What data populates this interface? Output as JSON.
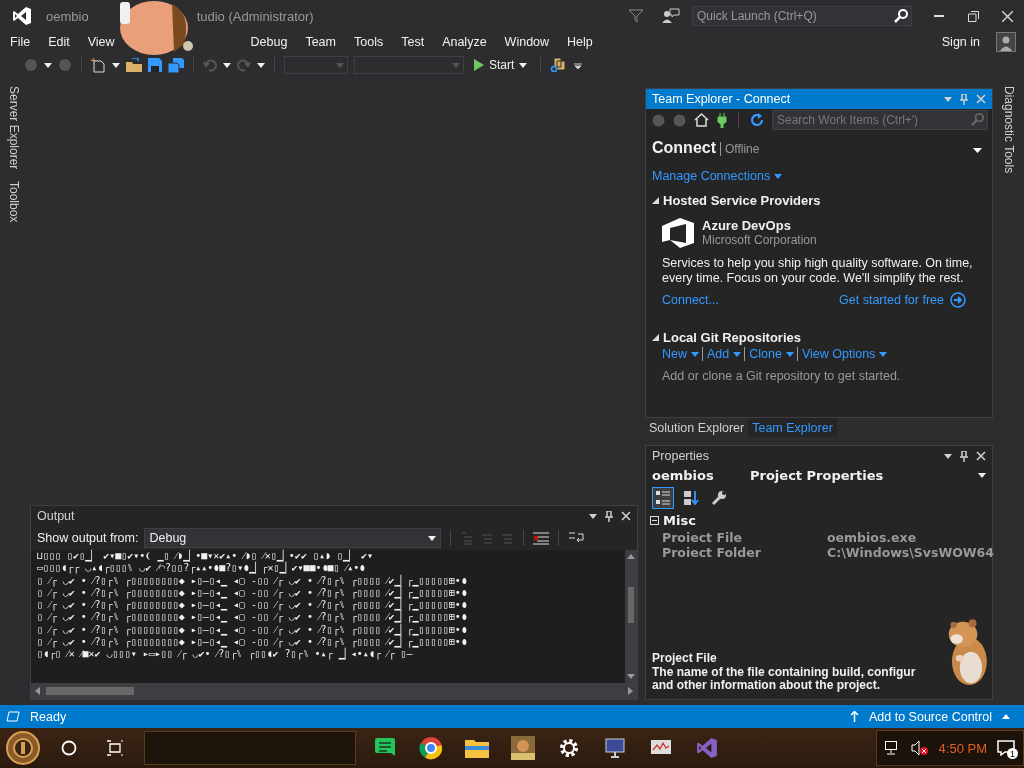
{
  "title_bar": {
    "title_start": "oembio",
    "title_end": "tudio  (Administrator)",
    "quick_launch": {
      "placeholder": "Quick Launch (Ctrl+Q)"
    }
  },
  "menu": {
    "items_before_overlay": [
      "File",
      "Edit",
      "View"
    ],
    "items_after_overlay": [
      "Debug",
      "Team",
      "Tools",
      "Test",
      "Analyze",
      "Window",
      "Help"
    ]
  },
  "account": {
    "sign_in": "Sign in"
  },
  "toolbar": {
    "start": "Start"
  },
  "side_tabs_left": [
    "Server Explorer",
    "Toolbox"
  ],
  "side_tabs_right": [
    "Diagnostic Tools"
  ],
  "team_explorer": {
    "title": "Team Explorer - Connect",
    "active": true,
    "search": {
      "placeholder": "Search Work Items (Ctrl+')"
    },
    "heading": "Connect",
    "status": "Offline",
    "manage": "Manage Connections",
    "hosted": {
      "title": "Hosted Service Providers",
      "expanded": true,
      "provider": "Azure DevOps",
      "company": "Microsoft Corporation",
      "description": "Services to help you ship high quality software. On time, every time. Focus on your code. We'll simplify the rest.",
      "connect": "Connect...",
      "get_started": "Get started for free"
    },
    "local_git": {
      "title": "Local Git Repositories",
      "expanded": true,
      "actions": [
        "New",
        "Add",
        "Clone",
        "View Options"
      ],
      "hint": "Add or clone a Git repository to get started."
    }
  },
  "panel_tabs": [
    {
      "label": "Solution Explorer",
      "selected": false
    },
    {
      "label": "Team Explorer",
      "selected": true
    }
  ],
  "properties": {
    "title": "Properties",
    "active": false,
    "object": "oembios",
    "object_type": "Project Properties",
    "view_buttons": [
      {
        "kind": "categorized",
        "selected": true
      },
      {
        "kind": "alphabetical",
        "selected": false
      },
      {
        "kind": "property-pages",
        "selected": false
      }
    ],
    "category": {
      "name": "Misc",
      "expanded": true,
      "rows": [
        {
          "name": "Proiect File",
          "value": "oembios.exe"
        },
        {
          "name": "Proiect Folder",
          "value": "C:\\Windows\\SvsWOW64"
        }
      ]
    },
    "description_title": "Project File",
    "description": "The name of the file containing build, configur\nand other information about the project."
  },
  "output": {
    "title": "Output",
    "active": false,
    "show_from": "Show output from:",
    "source": "Debug",
    "lines": [
      "⊔▯▯▯ ▯✔▯▁▏ ✔▾■▯✔▾•❨ ▁▯ ⁄◗▁▏•■▾✕✔▴• ⁄◗▯ ⁄✕▯▁▏•✔✔ ▯▴◗ ▯▁▏ ✔▾",
      "▭▯▯▯◖┌┌ ◡▴◖┌▯▯▯⑊ ◡✔ ⁄◠?▯▯?┌▴▴•⬮■?▯▾⬮▁▏┌✕▯▁▏✔▾■■•⬮■▯ ⁄▴•⬮",
      "▯ ⁄┌ ◡✔ • ⁄?▯┌⑊ ┌▯▯▯▯▯▯▯▯◆ ▸▯‒▯◂▁ ◂▢ ‑▯▯ ⁄┌ ◡✔ • ⁄?▯┌⑊ ┌▯▯▯▯ ⁄✔▁▏┌▁▯▯▯▯▯⊞•⬮",
      "▯ ⁄┌ ◡✔ • ⁄?▯┌⑊ ┌▯▯▯▯▯▯▯▯◆ ▸▯‒▯◂▁ ◂▢ ‑▯▯ ⁄┌ ◡✔ • ⁄?▯┌⑊ ┌▯▯▯▯ ⁄✔▁▏┌▁▯▯▯▯▯⊞•⬮",
      "▯ ⁄┌ ◡✔ • ⁄?▯┌⑊ ┌▯▯▯▯▯▯▯▯◆ ▸▯‒▯◂▁ ◂▢ ‑▯▯ ⁄┌ ◡✔ • ⁄?▯┌⑊ ┌▯▯▯▯ ⁄✔▁▏┌▁▯▯▯▯▯⊞•⬮",
      "▯ ⁄┌ ◡✔ • ⁄?▯┌⑊ ┌▯▯▯▯▯▯▯▯◆ ▸▯‒▯◂▁ ◂▢ ‑▯▯ ⁄┌ ◡✔ • ⁄?▯┌⑊ ┌▯▯▯▯ ⁄✔▁▏┌▁▯▯▯▯▯⊞•⬮",
      "▯ ⁄┌ ◡✔ • ⁄?▯┌⑊ ┌▯▯▯▯▯▯▯▯◆ ▸▯‒▯◂▁ ◂▢ ‑▯▯ ⁄┌ ◡✔ • ⁄?▯┌⑊ ┌▯▯▯▯ ⁄✔▁▏┌▁▯▯▯▯▯⊞•⬮",
      "▯ ⁄┌ ◡✔ • ⁄?▯┌⑊ ┌▯▯▯▯▯▯▯▯◆ ▸▯‒▯◂▁ ◂▢ ‑▯▯ ⁄┌ ◡✔ • ⁄?▯┌⑊ ┌▯▯▯▯ ⁄✔▁▏┌▁▯▯▯▯▯⊞•⬮",
      "▯◖┌▯ ⁄✕ ⁄■✕✔ ◡▯▯▯▾ ▸▭▸▯▯ ⁄┌ ◡✔• ⁄?▯┌⑊ ┌▯▯◖✔ ?▯┌⑊ •▴┌ ▁▏◂•▴◖┌ ⁄┌ ▯‒"
    ]
  },
  "status_bar": {
    "status": "Ready",
    "action": "Add to Source Control"
  },
  "taskbar": {
    "time": "4:50 PM",
    "notification_count": "1"
  }
}
